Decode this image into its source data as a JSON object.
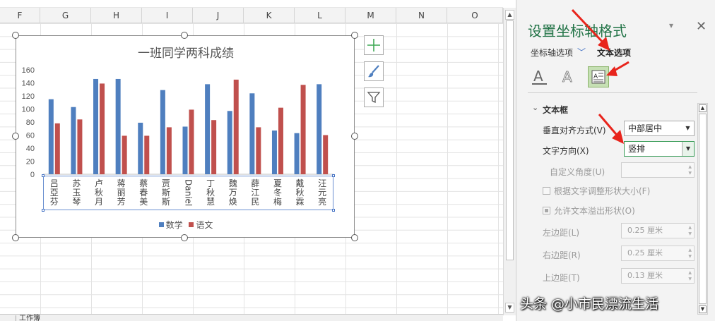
{
  "sheet": {
    "columns": [
      "F",
      "G",
      "H",
      "I",
      "J",
      "K",
      "L",
      "M",
      "N",
      "O"
    ],
    "tab_label": "工作簿"
  },
  "chart": {
    "side_buttons": [
      "add-element-icon",
      "brush-icon",
      "filter-icon"
    ]
  },
  "chart_data": {
    "type": "bar",
    "title": "一班同学两科成绩",
    "categories": [
      "吕亞芬",
      "苏玉琴",
      "卢秋月",
      "蒋丽芳",
      "蔡春美",
      "贾斯斯",
      "Daniel",
      "丁秋慧",
      "魏万焕",
      "薛江民",
      "夏冬梅",
      "戴秋霖",
      "汪元亮"
    ],
    "series": [
      {
        "name": "数学",
        "color": "#4f7fbf",
        "values": [
          115,
          103,
          146,
          146,
          79,
          129,
          73,
          138,
          97,
          124,
          67,
          63,
          138
        ]
      },
      {
        "name": "语文",
        "color": "#c0504d",
        "values": [
          78,
          84,
          139,
          59,
          59,
          72,
          99,
          83,
          145,
          72,
          102,
          137,
          60
        ]
      }
    ],
    "ylim": [
      0,
      160
    ],
    "yticks": [
      "160",
      "140",
      "120",
      "100",
      "80",
      "60",
      "40",
      "20",
      "0"
    ],
    "legend": "bottom",
    "grid": false
  },
  "panel": {
    "title": "设置坐标轴格式",
    "tab_axis": "坐标轴选项",
    "tab_text": "文本选项",
    "section": "文本框",
    "vertical_align_label": "垂直对齐方式(V)",
    "vertical_align_value": "中部居中",
    "text_dir_label": "文字方向(X)",
    "text_dir_value": "竖排",
    "custom_angle_label": "自定义角度(U)",
    "check_resize": "根据文字调整形状大小(F)",
    "check_overflow": "允许文本溢出形状(O)",
    "left_margin_label": "左边距(L)",
    "left_margin_value": "0.25 厘米",
    "right_margin_label": "右边距(R)",
    "right_margin_value": "0.25 厘米",
    "top_margin_label": "上边距(T)",
    "top_margin_value": "0.13 厘米",
    "accent": "#217346"
  },
  "watermark": "头条 @小市民漂流生活"
}
